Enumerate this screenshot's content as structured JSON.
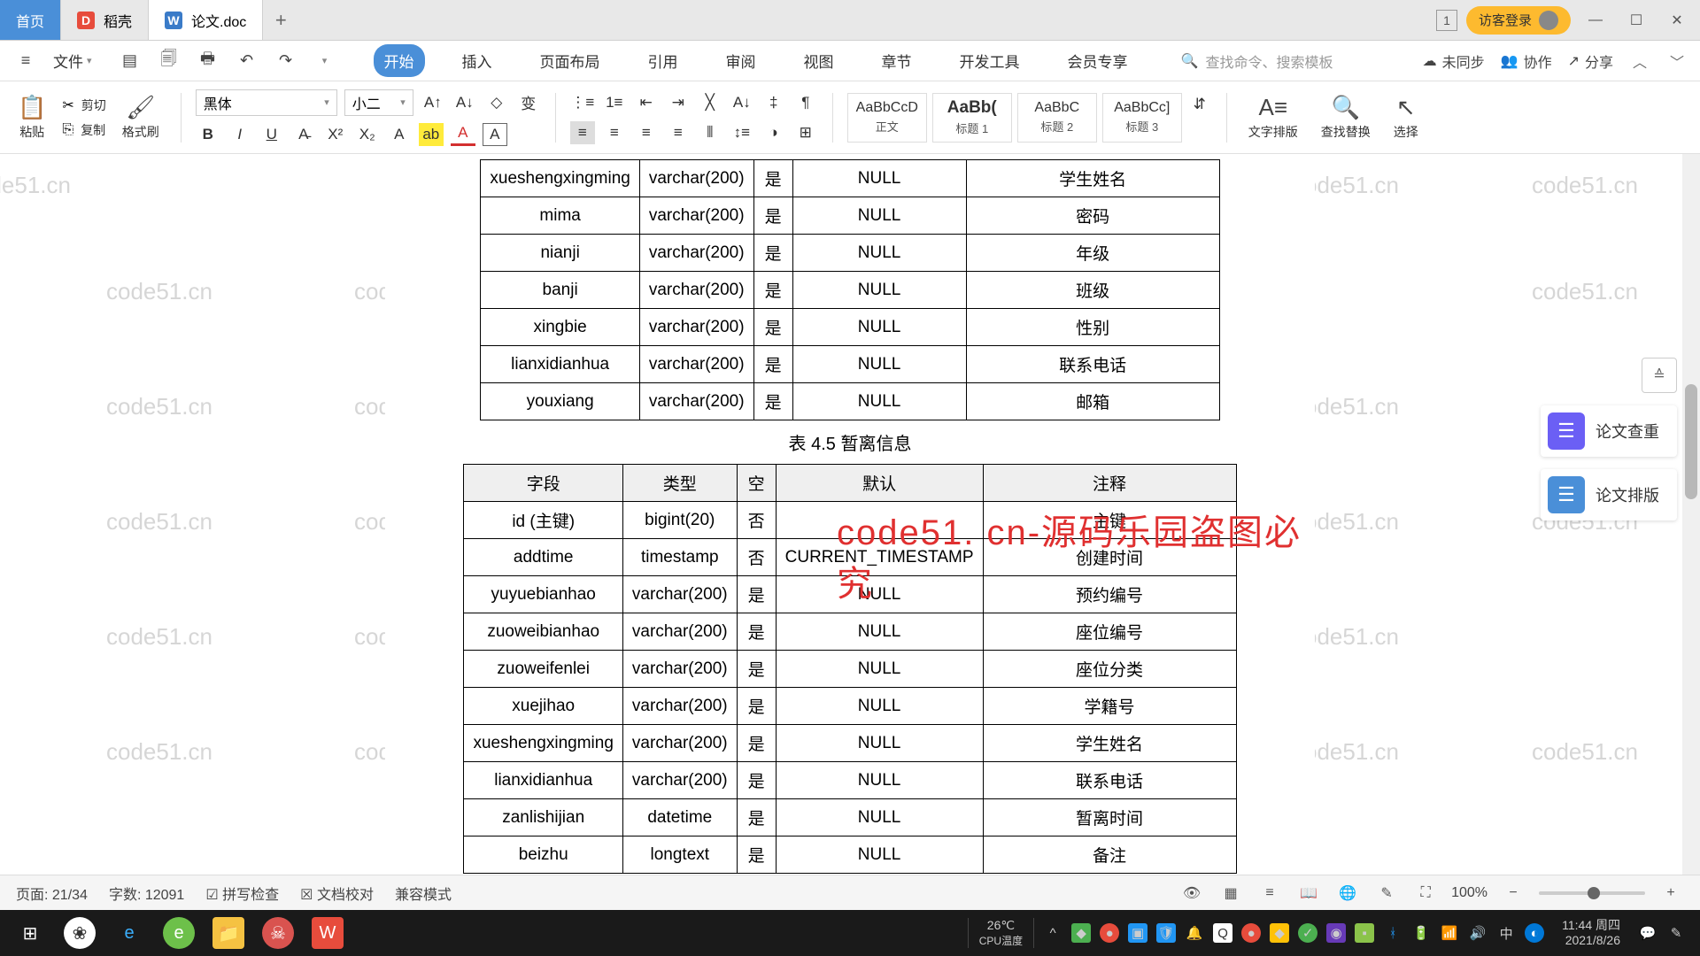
{
  "titlebar": {
    "tabs": [
      {
        "icon": "",
        "label": "首页",
        "home": true
      },
      {
        "icon": "D",
        "label": "稻壳"
      },
      {
        "icon": "W",
        "label": "论文.doc",
        "active": true
      }
    ],
    "num_badge": "1",
    "login_chip": "访客登录"
  },
  "menubar": {
    "file": "文件",
    "items": [
      "开始",
      "插入",
      "页面布局",
      "引用",
      "审阅",
      "视图",
      "章节",
      "开发工具",
      "会员专享"
    ],
    "active_index": 0,
    "search_placeholder": "查找命令、搜索模板",
    "right": {
      "unsync": "未同步",
      "collab": "协作",
      "share": "分享"
    }
  },
  "ribbon": {
    "paste": "粘贴",
    "cut": "剪切",
    "copy": "复制",
    "format_painter": "格式刷",
    "font_name": "黑体",
    "font_size": "小二",
    "styles": [
      {
        "prev": "AaBbCcD",
        "name": "正文"
      },
      {
        "prev": "AaBb(",
        "name": "标题 1",
        "h1": true
      },
      {
        "prev": "AaBbC",
        "name": "标题 2"
      },
      {
        "prev": "AaBbCc]",
        "name": "标题 3"
      }
    ],
    "text_layout": "文字排版",
    "find_replace": "查找替换",
    "select": "选择"
  },
  "table1": {
    "rows": [
      {
        "field": "xueshengxingming",
        "type": "varchar(200)",
        "nul": "是",
        "def": "NULL",
        "comment": "学生姓名"
      },
      {
        "field": "mima",
        "type": "varchar(200)",
        "nul": "是",
        "def": "NULL",
        "comment": "密码"
      },
      {
        "field": "nianji",
        "type": "varchar(200)",
        "nul": "是",
        "def": "NULL",
        "comment": "年级"
      },
      {
        "field": "banji",
        "type": "varchar(200)",
        "nul": "是",
        "def": "NULL",
        "comment": "班级"
      },
      {
        "field": "xingbie",
        "type": "varchar(200)",
        "nul": "是",
        "def": "NULL",
        "comment": "性别"
      },
      {
        "field": "lianxidianhua",
        "type": "varchar(200)",
        "nul": "是",
        "def": "NULL",
        "comment": "联系电话"
      },
      {
        "field": "youxiang",
        "type": "varchar(200)",
        "nul": "是",
        "def": "NULL",
        "comment": "邮箱"
      }
    ]
  },
  "caption2": "表 4.5  暂离信息",
  "table2": {
    "headers": {
      "field": "字段",
      "type": "类型",
      "nul": "空",
      "def": "默认",
      "comment": "注释"
    },
    "rows": [
      {
        "field": "id (主键)",
        "type": "bigint(20)",
        "nul": "否",
        "def": "",
        "comment": "主键"
      },
      {
        "field": "addtime",
        "type": "timestamp",
        "nul": "否",
        "def": "CURRENT_TIMESTAMP",
        "comment": "创建时间"
      },
      {
        "field": "yuyuebianhao",
        "type": "varchar(200)",
        "nul": "是",
        "def": "NULL",
        "comment": "预约编号"
      },
      {
        "field": "zuoweibianhao",
        "type": "varchar(200)",
        "nul": "是",
        "def": "NULL",
        "comment": "座位编号"
      },
      {
        "field": "zuoweifenlei",
        "type": "varchar(200)",
        "nul": "是",
        "def": "NULL",
        "comment": "座位分类"
      },
      {
        "field": "xuejihao",
        "type": "varchar(200)",
        "nul": "是",
        "def": "NULL",
        "comment": "学籍号"
      },
      {
        "field": "xueshengxingming",
        "type": "varchar(200)",
        "nul": "是",
        "def": "NULL",
        "comment": "学生姓名"
      },
      {
        "field": "lianxidianhua",
        "type": "varchar(200)",
        "nul": "是",
        "def": "NULL",
        "comment": "联系电话"
      },
      {
        "field": "zanlishijian",
        "type": "datetime",
        "nul": "是",
        "def": "NULL",
        "comment": "暂离时间"
      },
      {
        "field": "beizhu",
        "type": "longtext",
        "nul": "是",
        "def": "NULL",
        "comment": "备注"
      }
    ]
  },
  "side": {
    "check": "论文查重",
    "layout": "论文排版"
  },
  "status": {
    "page": "页面: 21/34",
    "words": "字数: 12091",
    "spell": "拼写检查",
    "proof": "文档校对",
    "compat": "兼容模式",
    "zoom": "100%"
  },
  "watermark_text": "code51.cn",
  "red_watermark": "code51. cn-源码乐园盗图必究",
  "taskbar": {
    "weather": {
      "temp": "26℃",
      "label": "CPU温度"
    },
    "clock": {
      "time": "11:44 周四",
      "date": "2021/8/26"
    }
  }
}
